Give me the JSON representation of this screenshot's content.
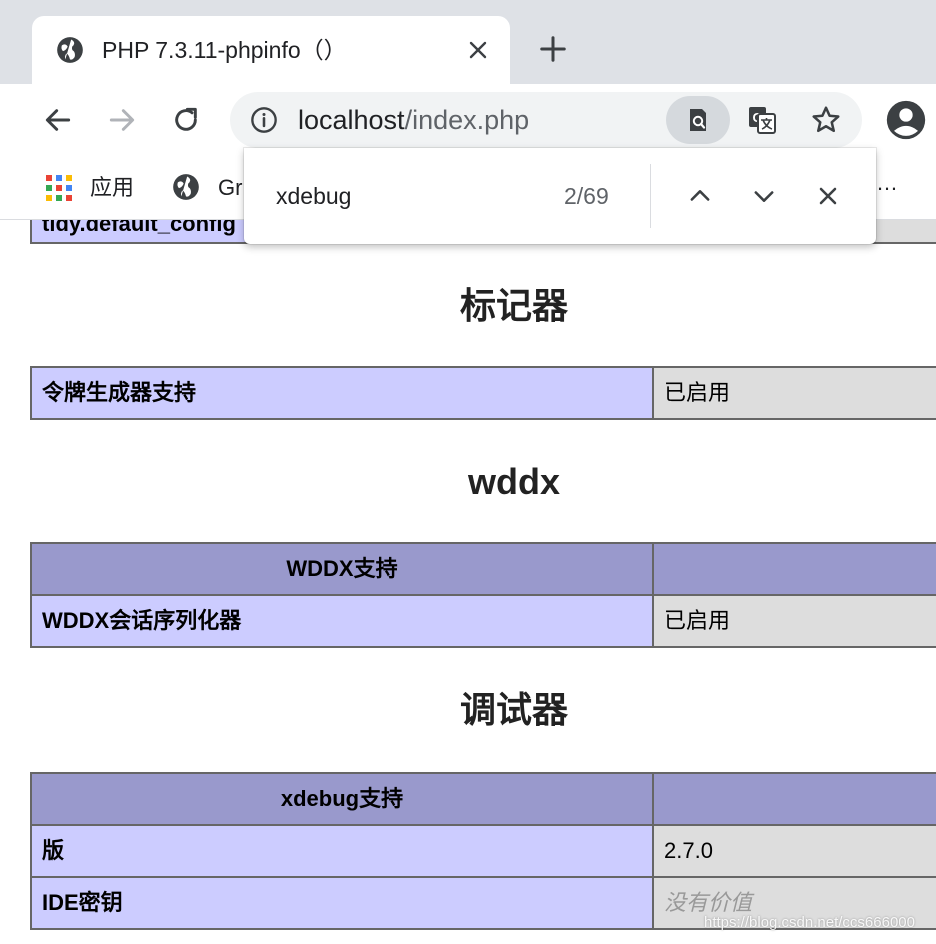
{
  "tab": {
    "title": "PHP 7.3.11-phpinfo（）",
    "favicon": "globe-icon"
  },
  "omnibox": {
    "host": "localhost",
    "path": "/index.php"
  },
  "bookmarks": {
    "apps_label": "应用",
    "item2_label": "Gr",
    "more": "…"
  },
  "findbar": {
    "query": "xdebug",
    "count": "2/69"
  },
  "page": {
    "prev_row_key": "tidy.default_config",
    "sections": [
      {
        "title": "标记器",
        "rows": [
          {
            "key": "令牌生成器支持",
            "value": "已启用"
          }
        ]
      },
      {
        "title": "wddx",
        "header": "WDDX支持",
        "rows": [
          {
            "key": "WDDX会话序列化器",
            "value": "已启用"
          }
        ]
      },
      {
        "title": "调试器",
        "header": "xdebug支持",
        "rows": [
          {
            "key": "版",
            "value": "2.7.0"
          },
          {
            "key": "IDE密钥",
            "value": "没有价值"
          }
        ]
      }
    ]
  },
  "watermark": "https://blog.csdn.net/ccs666000",
  "colors": {
    "tabstrip": "#dee1e6",
    "key_cell": "#ccccff",
    "value_cell": "#dddddd",
    "header_cell": "#9999cc"
  }
}
